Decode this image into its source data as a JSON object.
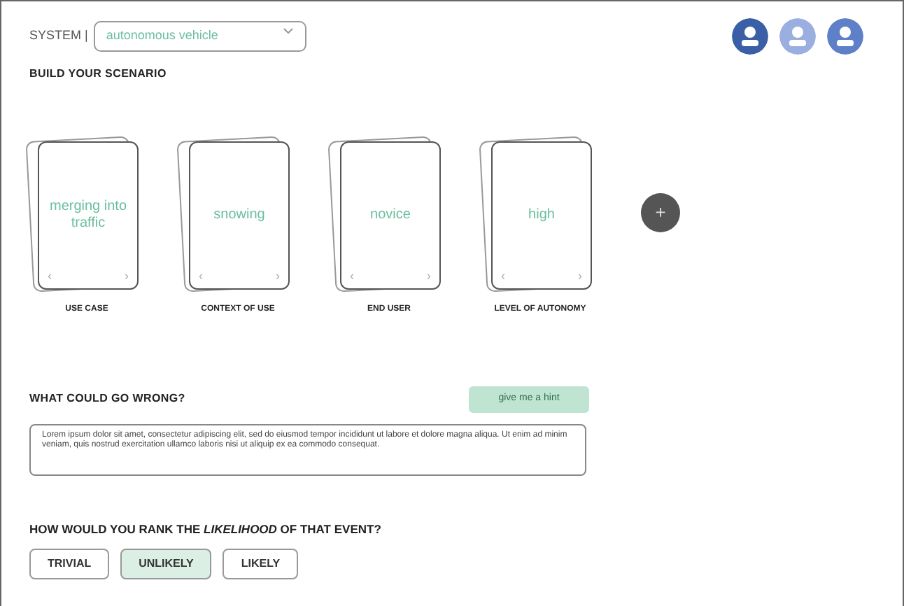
{
  "system": {
    "label": "SYSTEM |",
    "value": "autonomous vehicle"
  },
  "avatars": [
    {
      "color": "#3b5fa6"
    },
    {
      "color": "#9aaee0"
    },
    {
      "color": "#5e80c8"
    }
  ],
  "scenario": {
    "title": "BUILD YOUR SCENARIO",
    "cards": [
      {
        "value": "merging into traffic",
        "prev": "‹",
        "next": "›",
        "caption": "USE CASE"
      },
      {
        "value": "snowing",
        "prev": "‹",
        "next": "›",
        "caption": "CONTEXT OF USE"
      },
      {
        "value": "novice",
        "prev": "‹",
        "next": "›",
        "caption": "END USER"
      },
      {
        "value": "high",
        "prev": "‹",
        "next": "›",
        "caption": "LEVEL OF AUTONOMY"
      }
    ],
    "add_button": "+"
  },
  "wrong": {
    "title": "WHAT COULD GO WRONG?",
    "hint_button": "give me a hint",
    "text": "Lorem ipsum dolor sit amet, consectetur adipiscing elit, sed do eiusmod tempor incididunt ut labore et dolore magna aliqua. Ut enim ad minim veniam, quis nostrud exercitation ullamco laboris nisi ut aliquip ex ea commodo consequat."
  },
  "rank": {
    "question": "HOW WOULD YOU RANK THE *LIKELIHOOD* OF THAT EVENT?",
    "options": [
      {
        "label": "TRIVIAL",
        "selected": false
      },
      {
        "label": "UNLIKELY",
        "selected": true
      },
      {
        "label": "LIKELY",
        "selected": false
      }
    ]
  }
}
